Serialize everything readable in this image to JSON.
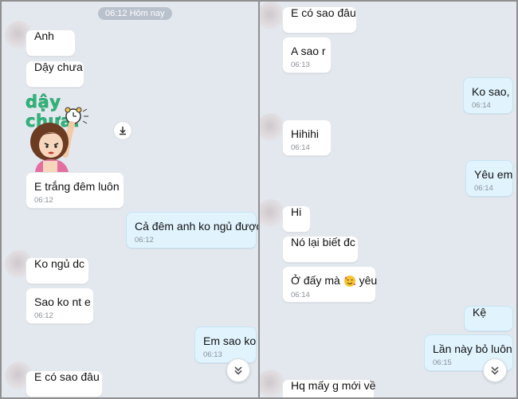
{
  "left": {
    "date_pill": "06:12 Hôm nay",
    "messages": [
      {
        "text": "Anh"
      },
      {
        "text": "Dậy chưa"
      },
      {
        "text": "E trắng đêm luôn",
        "time": "06:12"
      },
      {
        "text": "Cả đêm anh ko ngủ được",
        "time": "06:12"
      },
      {
        "text": "Ko ngủ dc"
      },
      {
        "text": "Sao ko nt e",
        "time": "06:12"
      },
      {
        "text": "Em sao ko",
        "time": "06:13"
      },
      {
        "text": "E có sao đâu"
      }
    ],
    "sticker_caption": "dậy chưa?"
  },
  "right": {
    "messages": [
      {
        "text": "E có sao đâu"
      },
      {
        "text": "A sao r",
        "time": "06:13"
      },
      {
        "text": "Ko sao,",
        "time": "06:14"
      },
      {
        "text": "Hihihi",
        "time": "06:14"
      },
      {
        "text": "Yêu em",
        "time": "06:14"
      },
      {
        "text": "Hi"
      },
      {
        "text": "Nó lại biết đc"
      },
      {
        "text_before": "Ở đấy mà",
        "text_after": "yêu",
        "time": "06:14"
      },
      {
        "text": "Kệ"
      },
      {
        "text": "Lần này bỏ luôn",
        "time": "06:15"
      },
      {
        "text": "Hq mấy g mới về"
      }
    ]
  },
  "icons": {
    "download": "download-icon",
    "scroll_down": "double-chevron-down-icon",
    "emoji": "smiling-face-with-hearts-icon"
  },
  "colors": {
    "background": "#e3e8ef",
    "incoming_bubble": "#ffffff",
    "outgoing_bubble": "#e1f4fe",
    "timestamp": "#8a8f96",
    "sticker_text": "#2fb77a"
  }
}
